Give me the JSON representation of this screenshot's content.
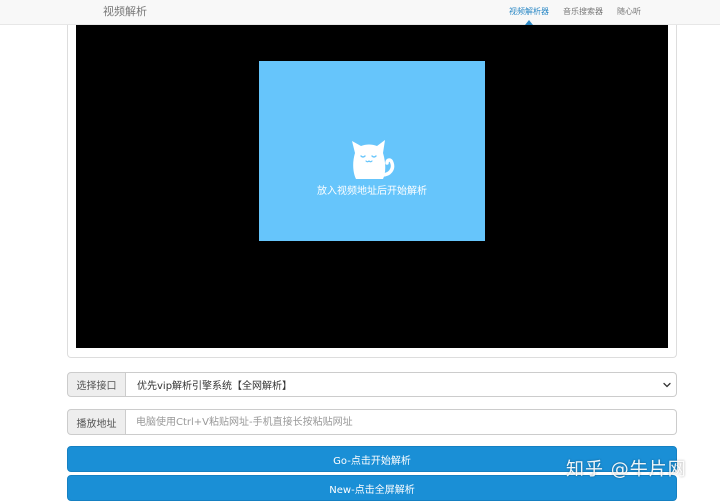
{
  "nav": {
    "brand": "视频解析",
    "links": [
      {
        "label": "视频解析器",
        "active": true
      },
      {
        "label": "音乐搜索器",
        "active": false
      },
      {
        "label": "随心听",
        "active": false
      }
    ]
  },
  "player": {
    "icon": "cat-icon",
    "placeholder_text": "放入视频地址后开始解析"
  },
  "form": {
    "interface_label": "选择接口",
    "interface_selected": "优先vip解析引擎系统【全网解析】",
    "url_label": "播放地址",
    "url_placeholder": "电脑使用Ctrl+V粘贴网址-手机直接长按粘贴网址"
  },
  "buttons": {
    "go": "Go-点击开始解析",
    "new": "New-点击全屏解析"
  },
  "watermark": "知乎 @牛片网",
  "colors": {
    "accent": "#1a8fd6",
    "card": "#66c5fb",
    "player_bg": "#000000",
    "nav_active": "#2e8ac6"
  }
}
